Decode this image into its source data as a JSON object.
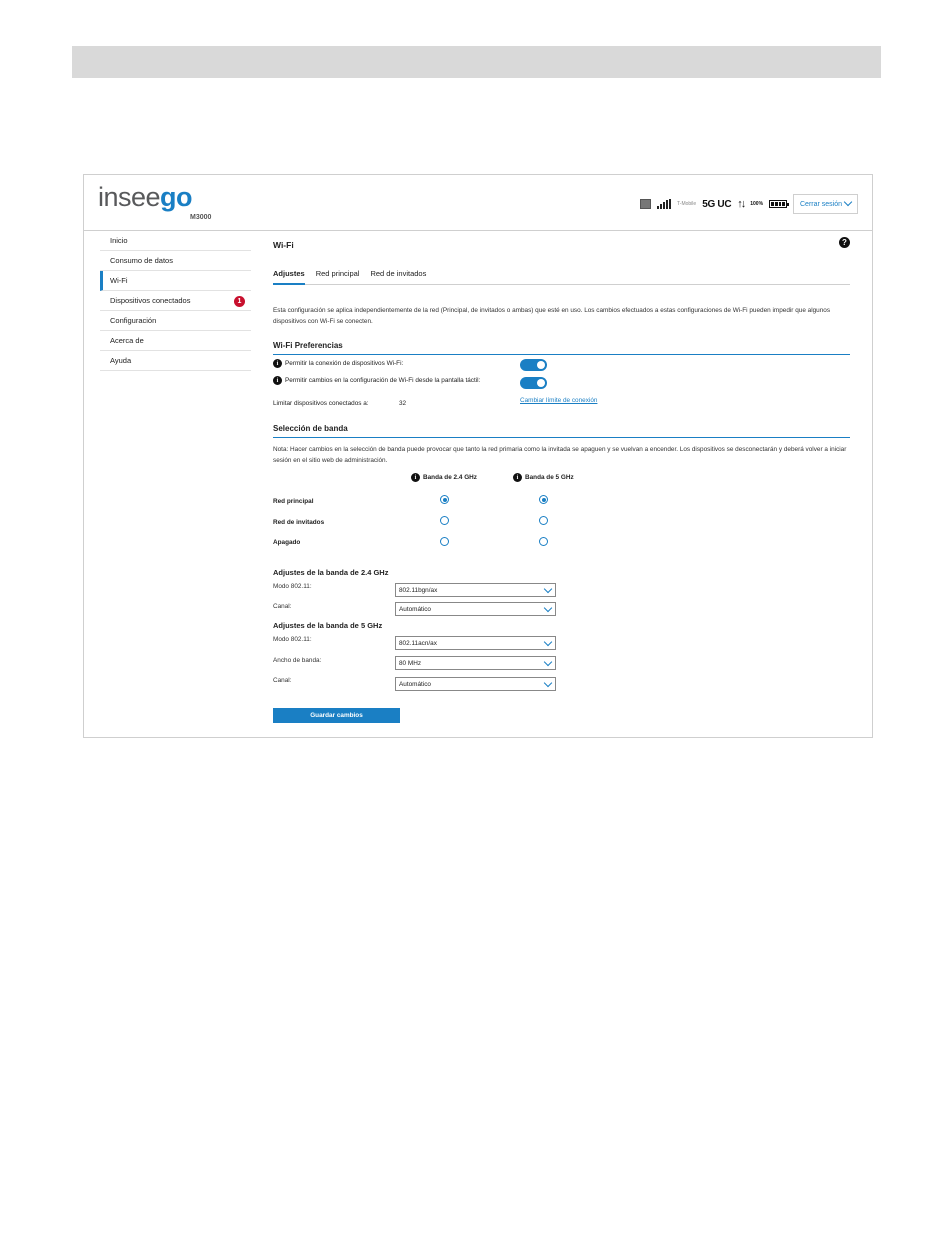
{
  "header": {
    "logo_main": "insee",
    "logo_accent": "go",
    "model": "M3000",
    "carrier": "T-Mobile",
    "network": "5G UC",
    "battery_pct": "100%",
    "logout_label": "Cerrar sesión"
  },
  "sidebar": {
    "items": [
      {
        "label": "Inicio"
      },
      {
        "label": "Consumo de datos"
      },
      {
        "label": "Wi-Fi"
      },
      {
        "label": "Dispositivos conectados",
        "badge": "1"
      },
      {
        "label": "Configuración"
      },
      {
        "label": "Acerca de"
      },
      {
        "label": "Ayuda"
      }
    ]
  },
  "main": {
    "title": "Wi-Fi",
    "help": "?",
    "tabs": [
      {
        "label": "Adjustes"
      },
      {
        "label": "Red principal"
      },
      {
        "label": "Red de invitados"
      }
    ],
    "description": "Esta configuración se aplica independientemente de la red (Principal, de invitados o ambas) que esté en uso. Los cambios efectuados a estas configuraciones de Wi-Fi pueden impedir que algunos dispositivos con Wi-Fi se conecten.",
    "preferences": {
      "title": "Wi-Fi Preferencias",
      "allow_connection": "Permitir la conexión de dispositivos Wi-Fi:",
      "allow_touchscreen": "Permitir cambios en la configuración de Wi-Fi desde la pantalla táctil:",
      "limit_label": "Limitar dispositivos conectados a:",
      "limit_value": "32",
      "limit_link": "Cambiar límite de conexión"
    },
    "band_selection": {
      "title": "Selección de banda",
      "note": "Nota: Hacer cambios en la selección de banda puede provocar que tanto la red primaria como la invitada se apaguen y se vuelvan a encender. Los dispositivos se desconectarán y deberá volver a iniciar sesión en el sitio web de administración.",
      "col_24": "Banda de 2.4 GHz",
      "col_5": "Banda de 5 GHz",
      "rows": [
        {
          "label": "Red principal"
        },
        {
          "label": "Red de invitados"
        },
        {
          "label": "Apagado"
        }
      ]
    },
    "band24": {
      "title": "Adjustes de la banda de 2.4 GHz",
      "mode_label": "Modo 802.11:",
      "mode_value": "802.11bgn/ax",
      "channel_label": "Canal:",
      "channel_value": "Automático"
    },
    "band5": {
      "title": "Adjustes de la banda de 5 GHz",
      "mode_label": "Modo 802.11:",
      "mode_value": "802.11acn/ax",
      "bandwidth_label": "Ancho de banda:",
      "bandwidth_value": "80 MHz",
      "channel_label": "Canal:",
      "channel_value": "Automático"
    },
    "save_label": "Guardar cambios"
  }
}
